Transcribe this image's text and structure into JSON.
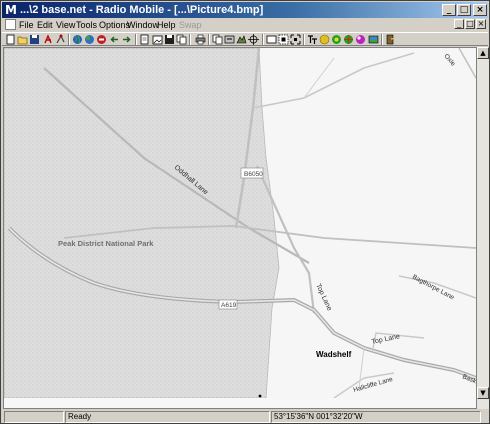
{
  "window": {
    "title": "...\\2 base.net - Radio Mobile - [...\\Picture4.bmp]",
    "app_icon_glyph": "M",
    "minimize_glyph": "_",
    "maximize_glyph": "□",
    "close_glyph": "×"
  },
  "menu": {
    "items": [
      "File",
      "Edit",
      "View",
      "Tools",
      "Options",
      "Window",
      "Help",
      "Swap"
    ],
    "disabled": [
      "Swap"
    ]
  },
  "toolbar": {
    "icons": [
      "new-icon",
      "open-icon",
      "save-icon",
      "network-properties-icon",
      "link-icon",
      "globe-icon",
      "world-icon",
      "stop-icon",
      "back-icon",
      "forward-icon",
      "page-icon",
      "open-picture-icon",
      "save-picture-icon",
      "copy-picture-icon",
      "print-icon",
      "copy-icon",
      "merge-icon",
      "elevation-grid-icon",
      "crosshair-icon",
      "frame-icon",
      "zoom-icon",
      "fit-icon",
      "text-icon",
      "map-color-icon",
      "coverage-icon",
      "polar-icon",
      "style-icon",
      "image-icon",
      "exit-icon"
    ]
  },
  "map": {
    "labels": {
      "road_oddhall": "Oddhall Lane",
      "badge_b6050": "B6050",
      "park": "Peak District National Park",
      "badge_a619": "A619",
      "top_lane_vertical": "Top Lane",
      "top_lane": "Top Lane",
      "wadshelf": "Wadshelf",
      "bagthorpe": "Bagthorpe Lane",
      "hallcliffe": "Hallcliffe Lane",
      "oxlee": "Oxle",
      "bask": "Bask"
    }
  },
  "status": {
    "message": "Ready",
    "coordinates": "53°15'36\"N 001°32'20\"W"
  },
  "scrollbar": {
    "up_glyph": "▲",
    "down_glyph": "▼",
    "left_glyph": "◀",
    "right_glyph": "▶"
  }
}
